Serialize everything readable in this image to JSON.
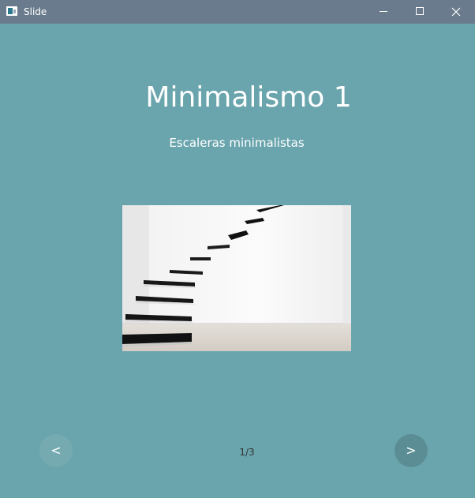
{
  "window": {
    "title": "Slide",
    "icon": "app-icon",
    "controls": {
      "minimize_icon": "minimize-icon",
      "maximize_icon": "maximize-icon",
      "close_icon": "close-icon"
    }
  },
  "slide": {
    "title": "Minimalismo 1",
    "subtitle": "Escaleras minimalistas",
    "image_description": "floating-staircase-photo"
  },
  "navigation": {
    "prev_label": "<",
    "next_label": ">",
    "page_indicator": "1/3"
  },
  "colors": {
    "background": "#6aa5ae",
    "titlebar": "#6a7b8d",
    "prev_button": "#76aab1",
    "next_button": "#5b8e94"
  }
}
